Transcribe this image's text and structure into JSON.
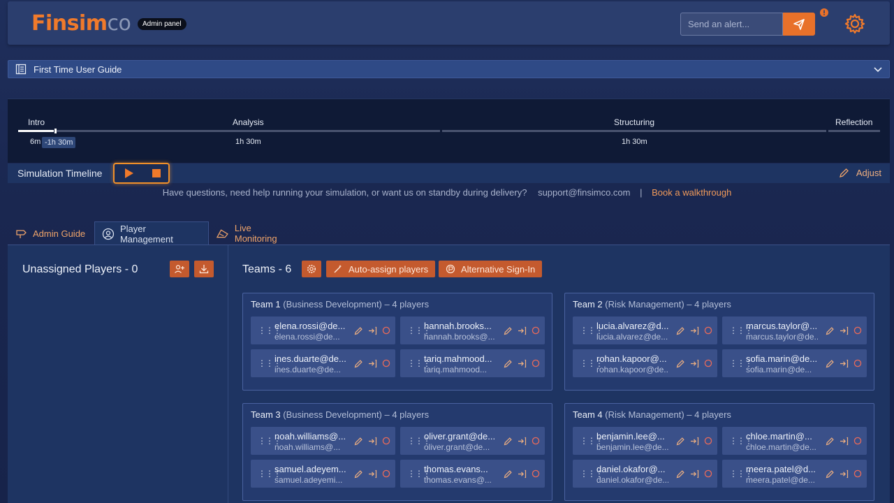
{
  "header": {
    "logo_part1": "Fin",
    "logo_part2": "sim",
    "logo_part3": "co",
    "badge": "Admin panel",
    "alert_placeholder": "Send an alert...",
    "accent": "#e8712a"
  },
  "guide": {
    "label": "First Time User Guide"
  },
  "timeline": {
    "phases": [
      {
        "name": "Intro",
        "duration": "6m"
      },
      {
        "name": "Analysis",
        "duration": "1h 30m"
      },
      {
        "name": "Structuring",
        "duration": "1h 30m"
      },
      {
        "name": "Reflection",
        "duration": ""
      }
    ],
    "tooltip": "-1h 30m",
    "label": "Simulation Timeline",
    "adjust": "Adjust"
  },
  "help": {
    "text": "Have questions, need help running your simulation, or want us on standby during delivery?",
    "email": "support@finsimco.com",
    "separator": "|",
    "link": "Book a walkthrough"
  },
  "tabs": [
    {
      "label": "Admin Guide",
      "icon": "signpost-icon"
    },
    {
      "label": "Player Management",
      "icon": "user-gear-icon"
    },
    {
      "label": "Live Monitoring",
      "icon": "monitor-icon"
    }
  ],
  "unassigned": {
    "title": "Unassigned Players - 0"
  },
  "teams_section": {
    "title": "Teams - 6",
    "auto_assign": "Auto-assign players",
    "alt_signin": "Alternative Sign-In"
  },
  "teams": [
    {
      "name": "Team 1",
      "detail": "(Business Development) – 4 players",
      "players": [
        {
          "email": "elena.rossi@de...",
          "sub": "elena.rossi@de..."
        },
        {
          "email": "hannah.brooks...",
          "sub": "hannah.brooks@..."
        },
        {
          "email": "ines.duarte@de...",
          "sub": "ines.duarte@de..."
        },
        {
          "email": "tariq.mahmood...",
          "sub": "tariq.mahmood..."
        }
      ]
    },
    {
      "name": "Team 2",
      "detail": "(Risk Management) – 4 players",
      "players": [
        {
          "email": "lucia.alvarez@d...",
          "sub": "lucia.alvarez@de..."
        },
        {
          "email": "marcus.taylor@...",
          "sub": "marcus.taylor@de..."
        },
        {
          "email": "rohan.kapoor@...",
          "sub": "rohan.kapoor@de..."
        },
        {
          "email": "sofia.marin@de...",
          "sub": "sofia.marin@de..."
        }
      ]
    },
    {
      "name": "Team 3",
      "detail": "(Business Development) – 4 players",
      "players": [
        {
          "email": "noah.williams@...",
          "sub": "noah.williams@..."
        },
        {
          "email": "oliver.grant@de...",
          "sub": "oliver.grant@de..."
        },
        {
          "email": "samuel.adeyem...",
          "sub": "samuel.adeyemi..."
        },
        {
          "email": "thomas.evans...",
          "sub": "thomas.evans@..."
        }
      ]
    },
    {
      "name": "Team 4",
      "detail": "(Risk Management) – 4 players",
      "players": [
        {
          "email": "benjamin.lee@...",
          "sub": "benjamin.lee@de..."
        },
        {
          "email": "chloe.martin@...",
          "sub": "chloe.martin@de..."
        },
        {
          "email": "daniel.okafor@...",
          "sub": "daniel.okafor@de..."
        },
        {
          "email": "meera.patel@d...",
          "sub": "meera.patel@de..."
        }
      ]
    }
  ]
}
